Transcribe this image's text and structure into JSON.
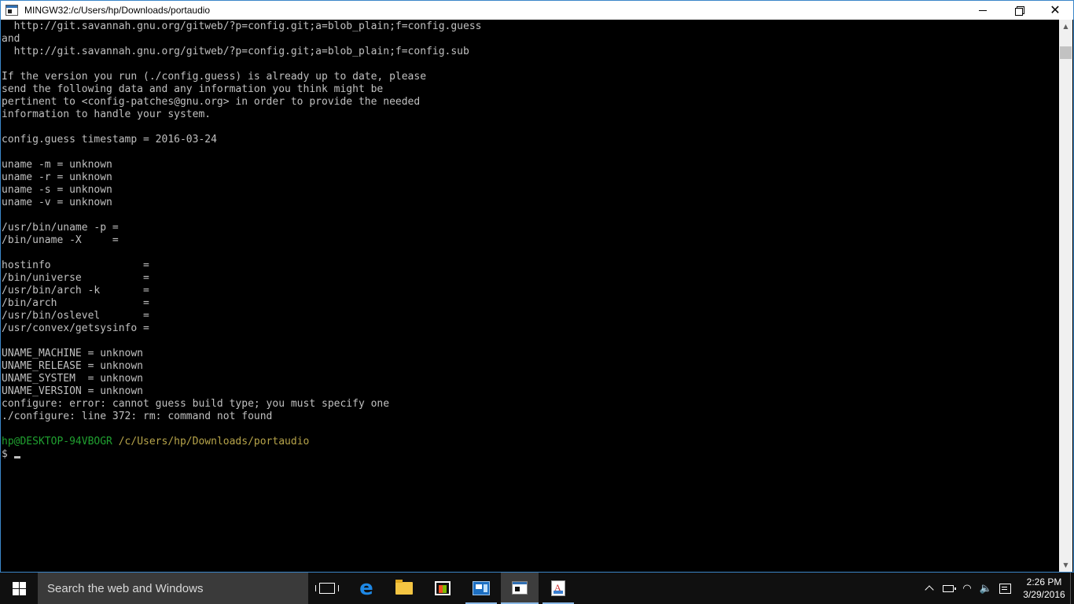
{
  "window": {
    "title": "MINGW32:/c/Users/hp/Downloads/portaudio",
    "close_glyph": "✕"
  },
  "terminal": {
    "lines": [
      "  http://git.savannah.gnu.org/gitweb/?p=config.git;a=blob_plain;f=config.guess",
      "and",
      "  http://git.savannah.gnu.org/gitweb/?p=config.git;a=blob_plain;f=config.sub",
      "",
      "If the version you run (./config.guess) is already up to date, please",
      "send the following data and any information you think might be",
      "pertinent to <config-patches@gnu.org> in order to provide the needed",
      "information to handle your system.",
      "",
      "config.guess timestamp = 2016-03-24",
      "",
      "uname -m = unknown",
      "uname -r = unknown",
      "uname -s = unknown",
      "uname -v = unknown",
      "",
      "/usr/bin/uname -p =",
      "/bin/uname -X     =",
      "",
      "hostinfo               =",
      "/bin/universe          =",
      "/usr/bin/arch -k       =",
      "/bin/arch              =",
      "/usr/bin/oslevel       =",
      "/usr/convex/getsysinfo =",
      "",
      "UNAME_MACHINE = unknown",
      "UNAME_RELEASE = unknown",
      "UNAME_SYSTEM  = unknown",
      "UNAME_VERSION = unknown",
      "configure: error: cannot guess build type; you must specify one",
      "./configure: line 372: rm: command not found",
      ""
    ],
    "prompt": {
      "user_host": "hp@DESKTOP-94VBOGR",
      "path": "/c/Users/hp/Downloads/portaudio",
      "symbol": "$"
    }
  },
  "scrollbar": {
    "up_glyph": "▲",
    "down_glyph": "▼"
  },
  "taskbar": {
    "search_placeholder": "Search the web and Windows",
    "edge_glyph": "e",
    "clock": {
      "time": "2:26 PM",
      "date": "3/29/2016"
    },
    "tray": {
      "wifi_glyph": "◠",
      "volume_glyph": "🔈"
    }
  },
  "colors": {
    "prompt_user": "#20a030",
    "prompt_path": "#b7a44a",
    "terminal_text": "#c0c0c0",
    "taskbar": "#101010"
  }
}
